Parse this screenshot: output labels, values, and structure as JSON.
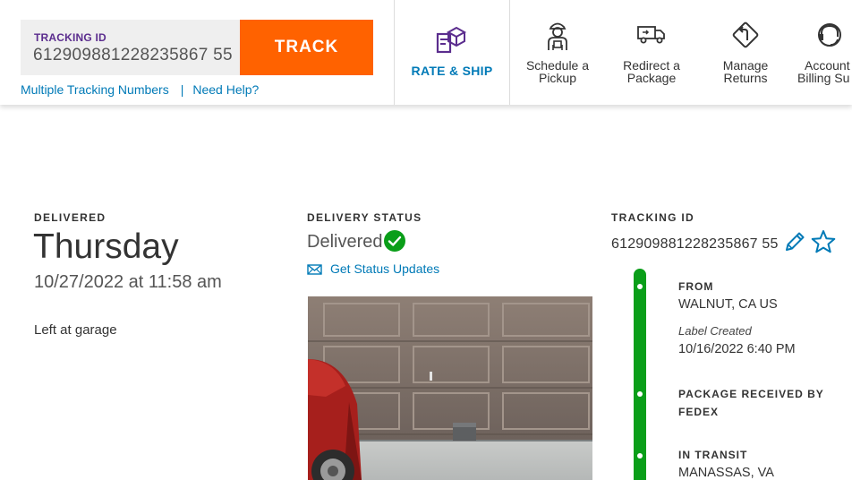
{
  "header": {
    "tracking_label": "TRACKING ID",
    "tracking_value": "612909881228235867 55",
    "track_button": "TRACK",
    "multiple_link": "Multiple Tracking Numbers",
    "separator": "|",
    "help_link": "Need Help?",
    "nav": {
      "rate_ship": "RATE & SHIP",
      "schedule": [
        "Schedule a",
        "Pickup"
      ],
      "redirect": [
        "Redirect a",
        "Package"
      ],
      "returns": [
        "Manage",
        "Returns"
      ],
      "account": [
        "Account",
        "Billing Su"
      ]
    }
  },
  "delivered": {
    "label": "DELIVERED",
    "day": "Thursday",
    "datetime": "10/27/2022 at 11:58 am",
    "note": "Left at garage"
  },
  "status": {
    "label": "DELIVERY STATUS",
    "value": "Delivered",
    "updates_link": "Get Status Updates"
  },
  "tracking": {
    "label": "TRACKING ID",
    "value": "612909881228235867 55",
    "timeline": [
      {
        "head": "FROM",
        "value": "WALNUT, CA US",
        "sub": "Label Created",
        "sub_value": "10/16/2022 6:40 PM"
      },
      {
        "head": "PACKAGE RECEIVED BY",
        "head2": "FEDEX"
      },
      {
        "head": "IN TRANSIT",
        "value": "MANASSAS, VA"
      }
    ]
  },
  "colors": {
    "brand_purple": "#5b2d8e",
    "brand_orange": "#ff6200",
    "link_blue": "#007ab7",
    "success_green": "#0a9e19"
  }
}
